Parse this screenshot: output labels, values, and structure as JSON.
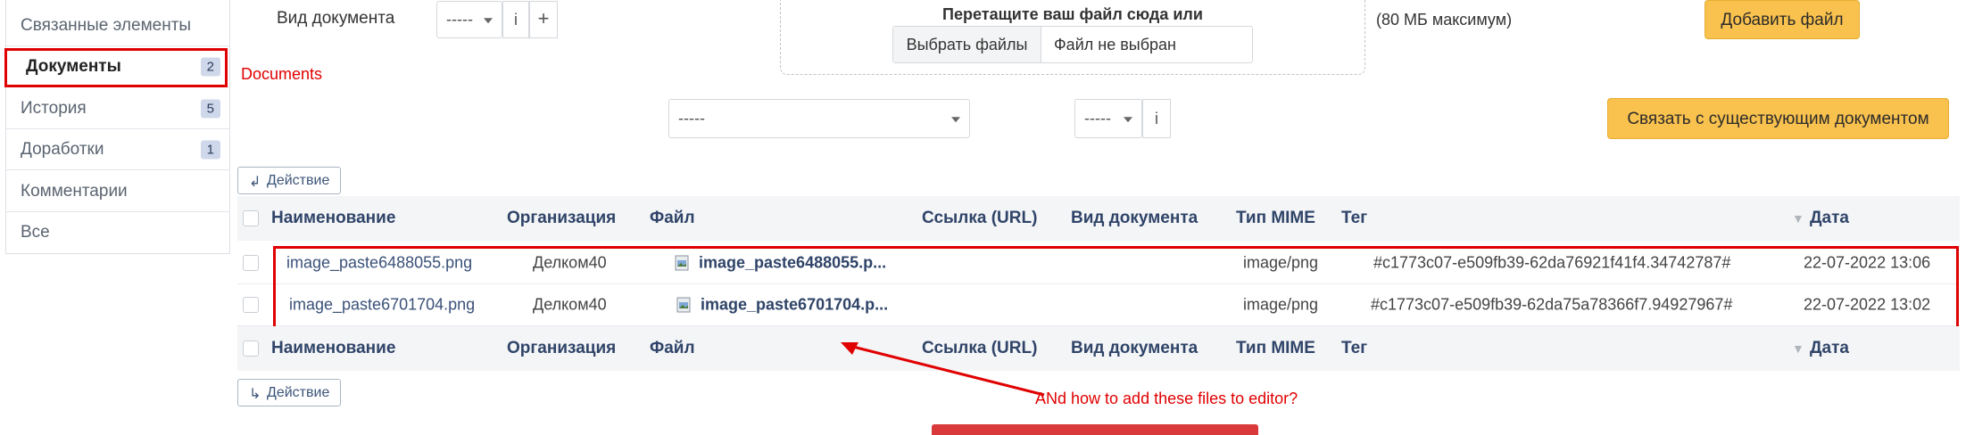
{
  "sidebar": {
    "items": [
      {
        "label": "Связанные элементы",
        "count": null
      },
      {
        "label": "Документы",
        "count": "2"
      },
      {
        "label": "История",
        "count": "5"
      },
      {
        "label": "Доработки",
        "count": "1"
      },
      {
        "label": "Комментарии",
        "count": null
      },
      {
        "label": "Все",
        "count": null
      }
    ]
  },
  "annotations": {
    "documents_note": "Documents",
    "question": "ANd how to add these files to editor?"
  },
  "upload": {
    "doc_type_label": "Вид документа",
    "doc_type_value": "-----",
    "info_symbol": "i",
    "plus_symbol": "+",
    "drop_text": "Перетащите ваш файл сюда или",
    "choose_files": "Выбрать файлы",
    "no_file": "Файл не выбран",
    "max_size": "(80 МБ максимум)",
    "add_file": "Добавить файл"
  },
  "link": {
    "select_value": "-----",
    "type_value": "-----",
    "info_symbol": "i",
    "link_button": "Связать с существующим документом"
  },
  "actions": {
    "label": "Действие"
  },
  "table": {
    "sort_arrow": "▼",
    "columns": [
      "Наименование",
      "Организация",
      "Файл",
      "Ссылка (URL)",
      "Вид документа",
      "Тип MIME",
      "Тег",
      "Дата"
    ],
    "rows": [
      {
        "name": "image_paste6488055.png",
        "org": "Делком40",
        "file": "image_paste6488055.p...",
        "url": "",
        "doc_type": "",
        "mime": "image/png",
        "tag": "#c1773c07-e509fb39-62da76921f41f4.34742787#",
        "date": "22-07-2022 13:06"
      },
      {
        "name": "image_paste6701704.png",
        "org": "Делком40",
        "file": "image_paste6701704.p...",
        "url": "",
        "doc_type": "",
        "mime": "image/png",
        "tag": "#c1773c07-e509fb39-62da75a78366f7.94927967#",
        "date": "22-07-2022 13:02"
      }
    ]
  },
  "colors": {
    "accent_red": "#e00000",
    "yellow_button": "#f9c14d",
    "header_text": "#2f4468"
  }
}
